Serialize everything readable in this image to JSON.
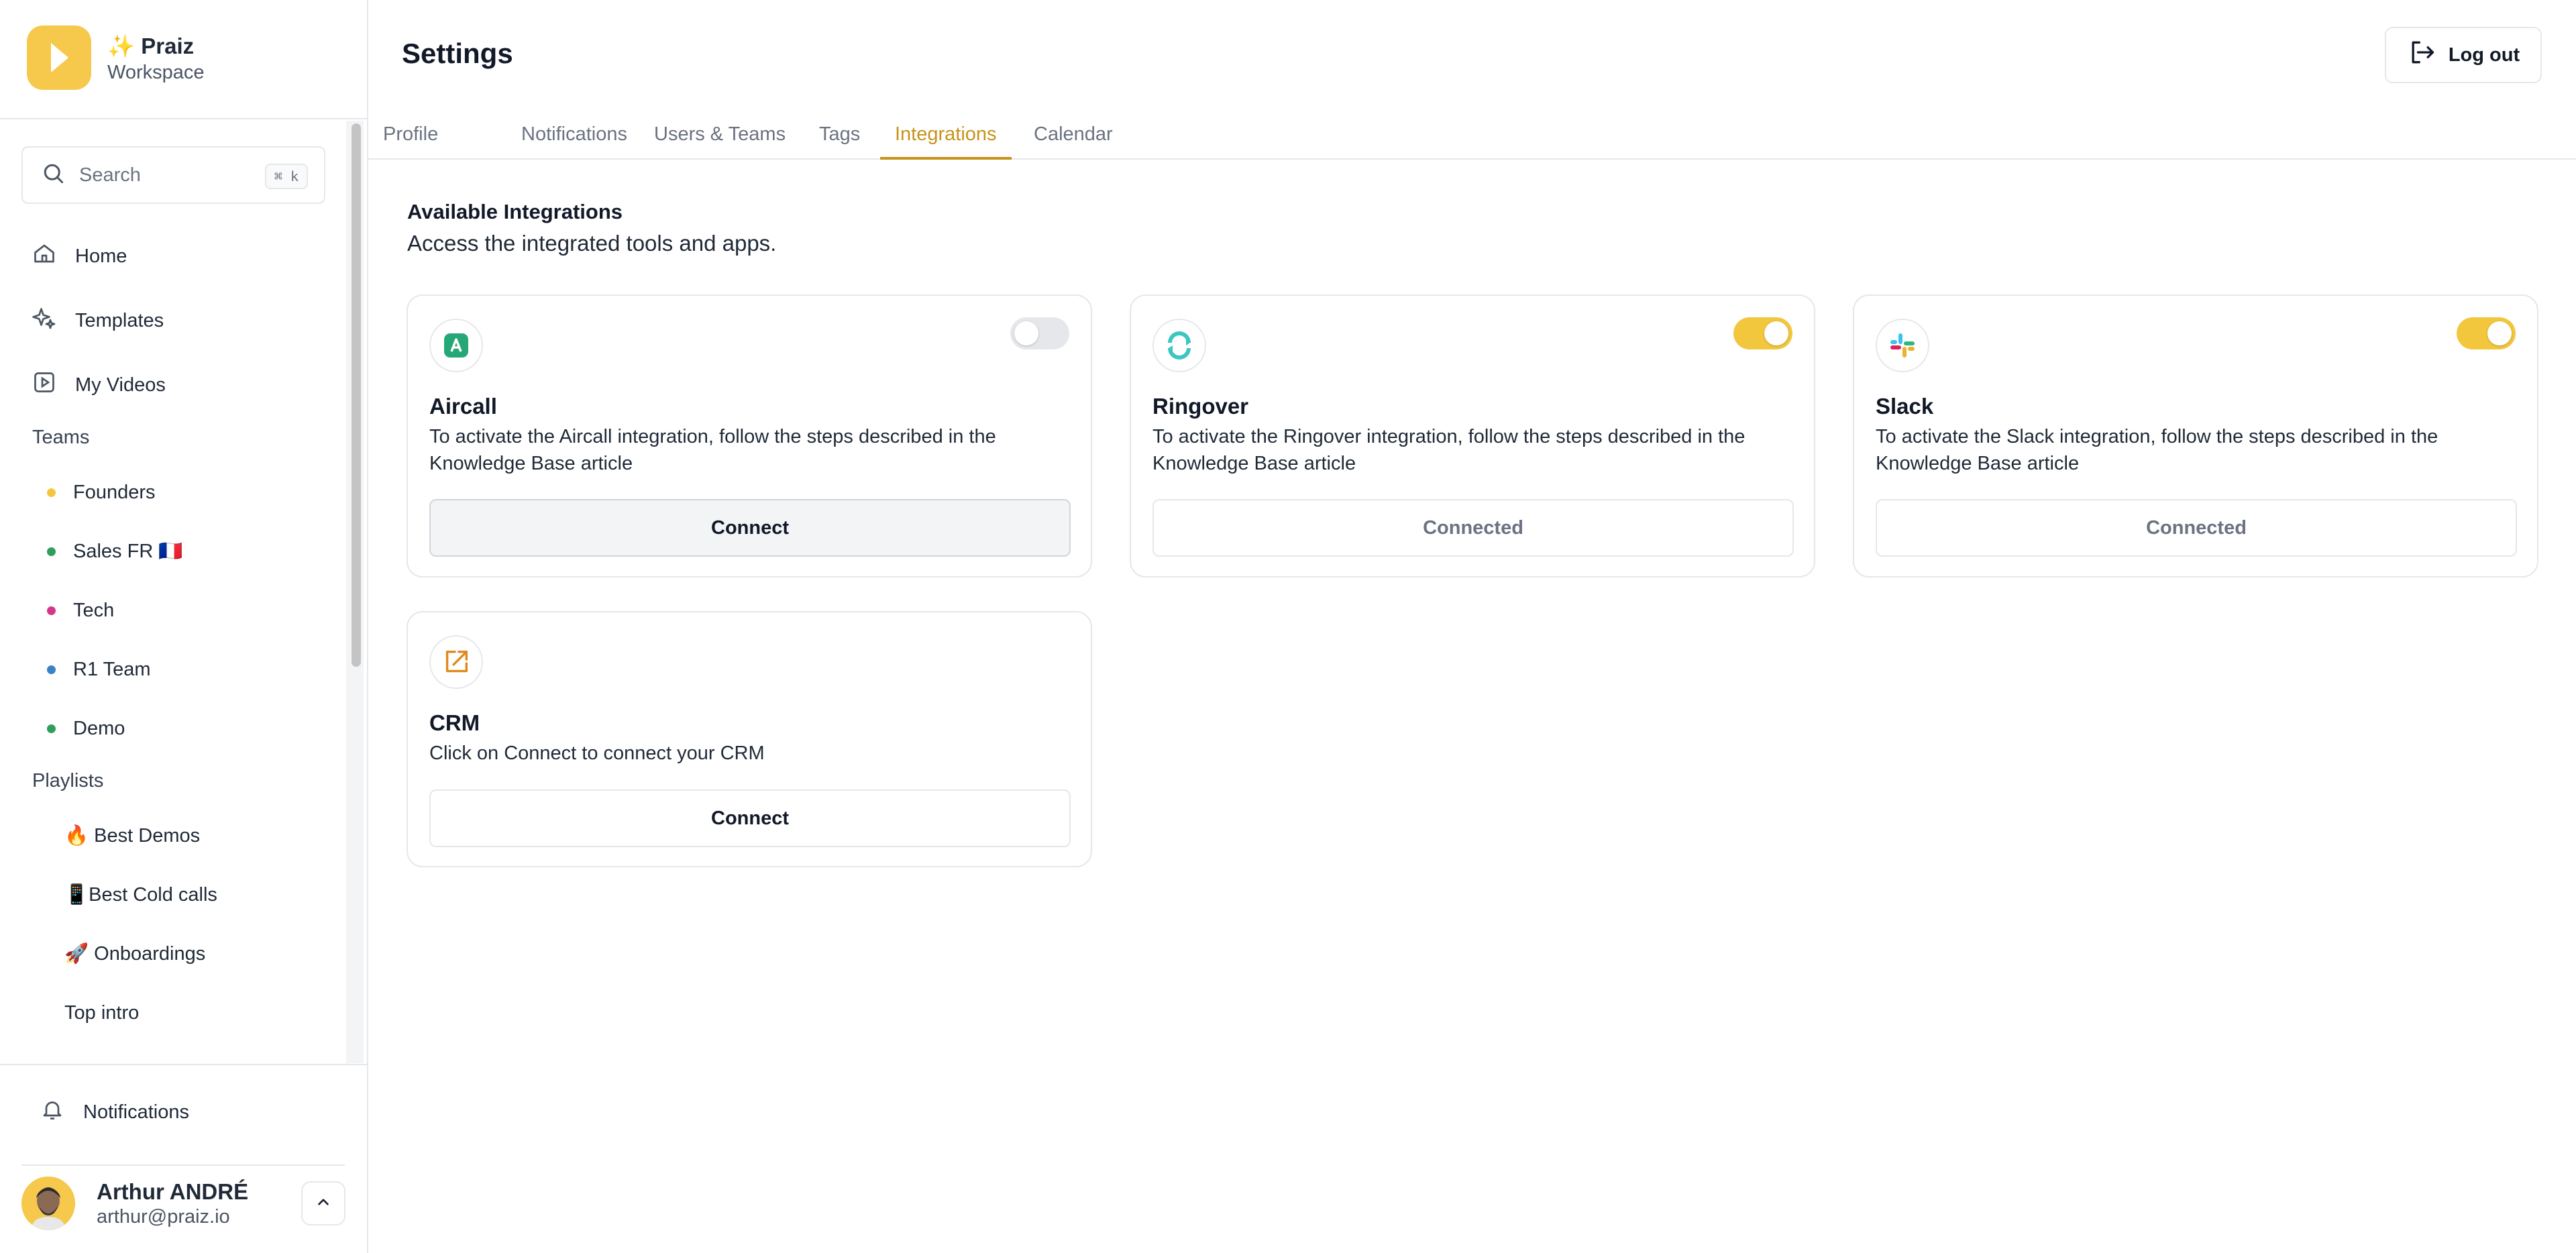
{
  "app": {
    "brand_name": "✨ Praiz",
    "brand_sub": "Workspace",
    "brand_color": "#f6c84c",
    "accent_color": "#c7931a"
  },
  "sidebar": {
    "search_placeholder": "Search",
    "search_shortcut": "⌘ k",
    "nav": [
      {
        "label": "Home",
        "icon": "home-icon"
      },
      {
        "label": "Templates",
        "icon": "sparkles-icon"
      },
      {
        "label": "My Videos",
        "icon": "video-icon"
      }
    ],
    "teams_title": "Teams",
    "teams": [
      {
        "label": "Founders",
        "color": "#f2c73e"
      },
      {
        "label": "Sales FR 🇫🇷",
        "color": "#2f9e5a"
      },
      {
        "label": "Tech",
        "color": "#d6368a"
      },
      {
        "label": "R1 Team",
        "color": "#3b82c4"
      },
      {
        "label": "Demo",
        "color": "#2f9e5a"
      }
    ],
    "playlists_title": "Playlists",
    "playlists": [
      {
        "label": "🔥 Best Demos"
      },
      {
        "label": "📱Best Cold calls"
      },
      {
        "label": "🚀 Onboardings"
      },
      {
        "label": "Top intro"
      }
    ],
    "notifications_label": "Notifications",
    "user": {
      "name": "Arthur ANDRÉ",
      "email": "arthur@praiz.io"
    }
  },
  "header": {
    "title": "Settings",
    "logout_label": "Log out"
  },
  "tabs": [
    {
      "label": "Profile",
      "active": false
    },
    {
      "label": "Notifications",
      "active": false
    },
    {
      "label": "Users & Teams",
      "active": false
    },
    {
      "label": "Tags",
      "active": false
    },
    {
      "label": "Integrations",
      "active": true
    },
    {
      "label": "Calendar",
      "active": false
    }
  ],
  "integrations": {
    "title": "Available Integrations",
    "subtitle": "Access the integrated tools and apps.",
    "cards": [
      {
        "name": "Aircall",
        "icon": "aircall-icon",
        "enabled": false,
        "description": "To activate the Aircall integration, follow the steps described in the Knowledge Base article",
        "button": "Connect"
      },
      {
        "name": "Ringover",
        "icon": "ringover-icon",
        "enabled": true,
        "description": "To activate the Ringover integration, follow the steps described in the Knowledge Base article",
        "button": "Connected"
      },
      {
        "name": "Slack",
        "icon": "slack-icon",
        "enabled": true,
        "description": "To activate the Slack integration, follow the steps described in the Knowledge Base article",
        "button": "Connected"
      },
      {
        "name": "CRM",
        "icon": "external-link-icon",
        "description": "Click on Connect to connect your CRM",
        "button": "Connect"
      }
    ]
  }
}
